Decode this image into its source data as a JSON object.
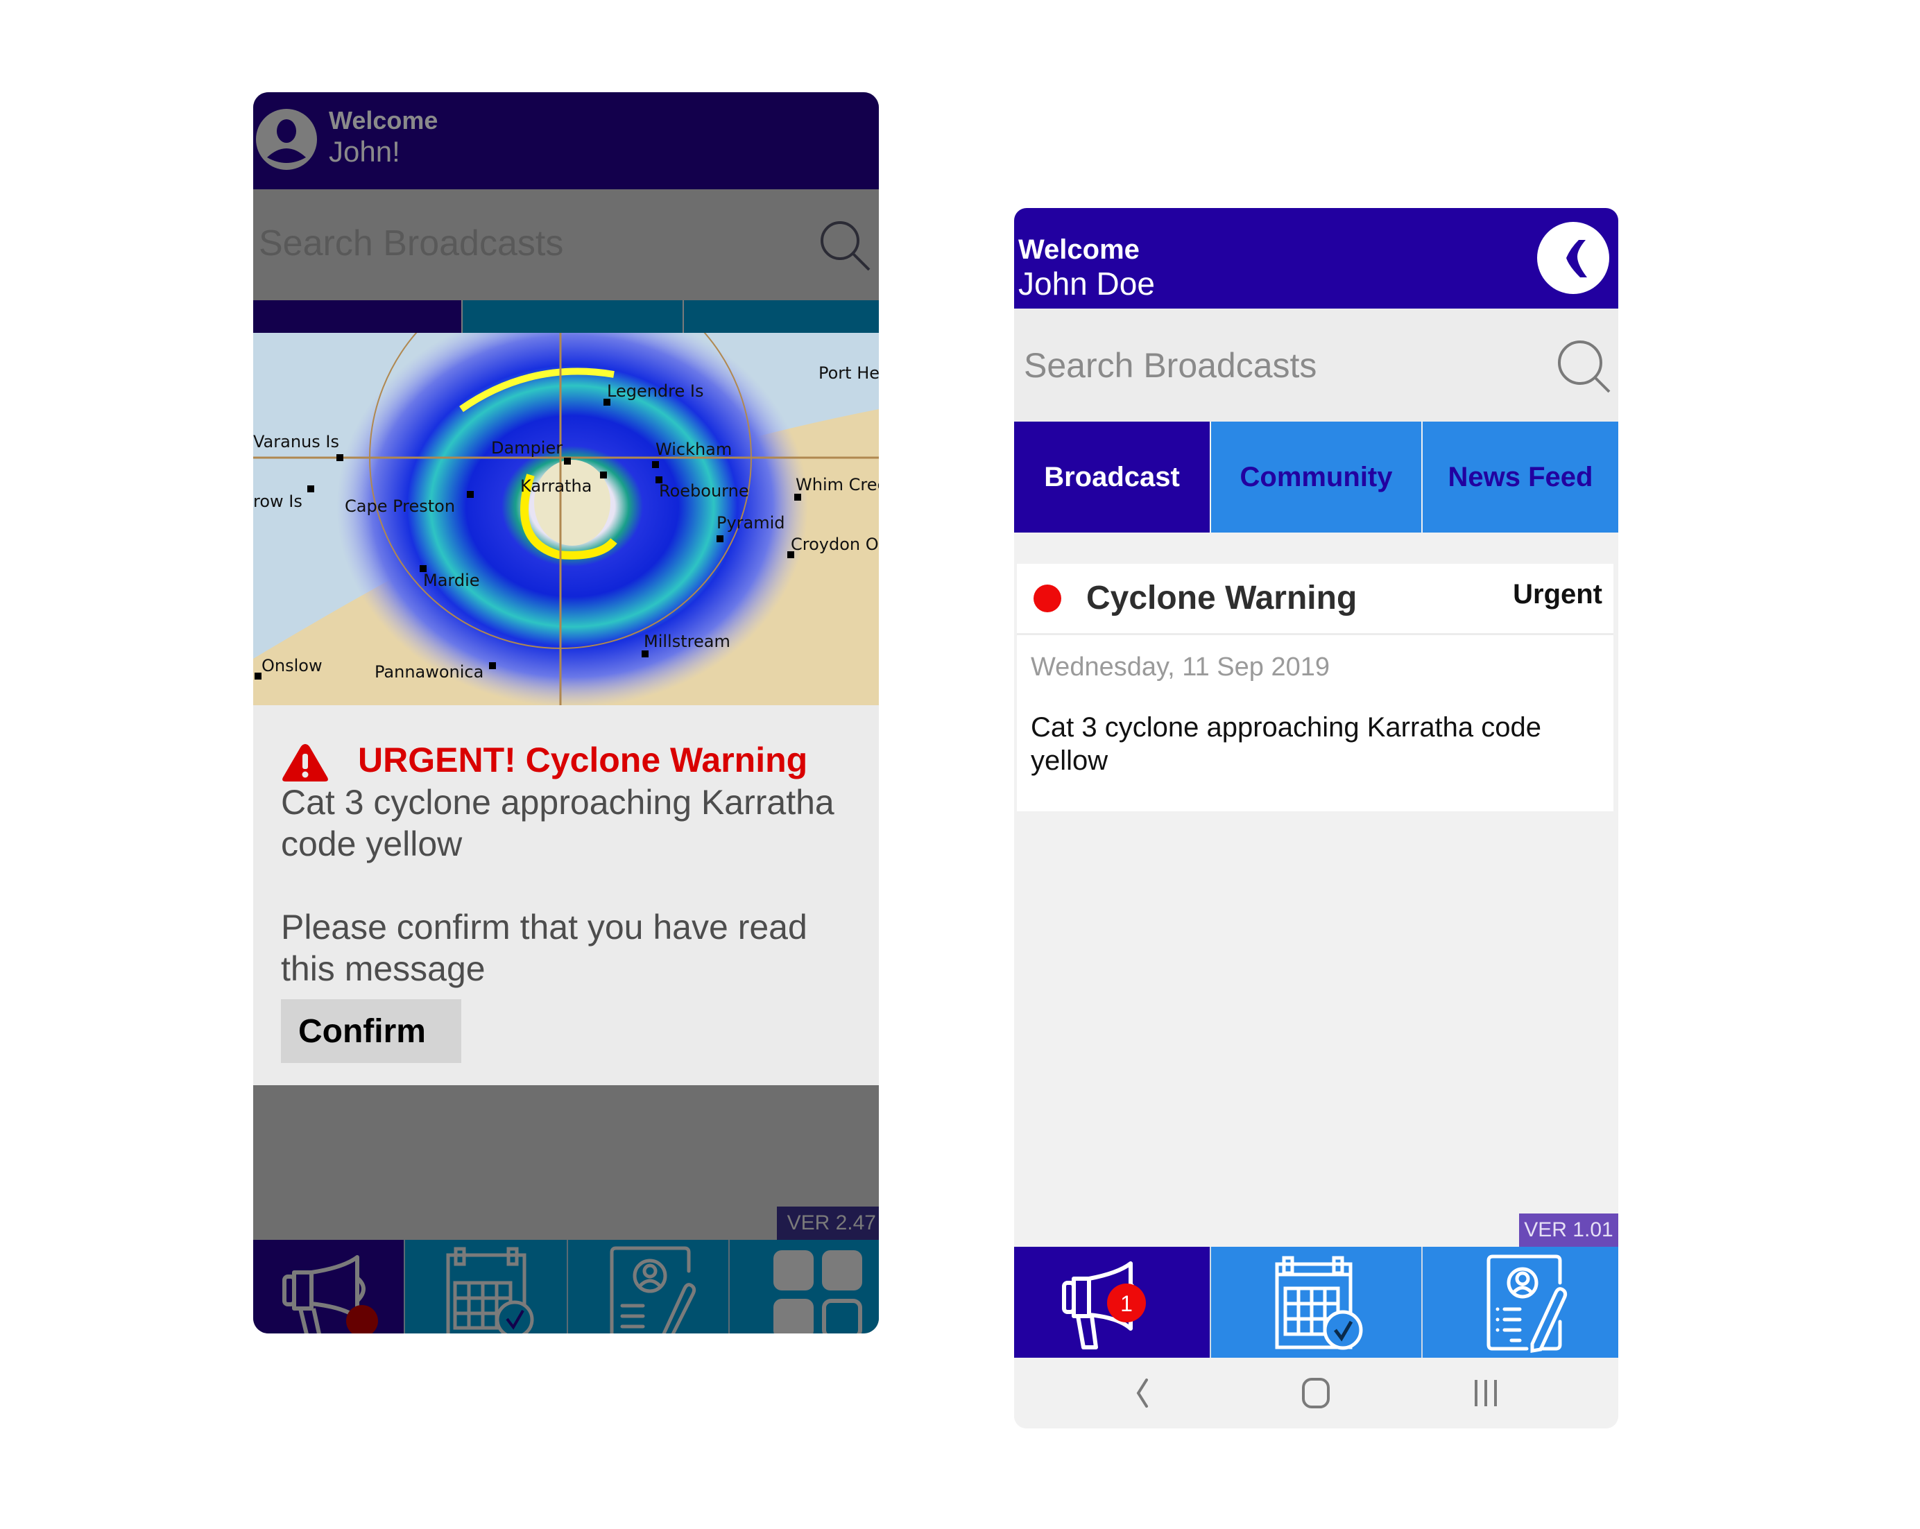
{
  "left_phone": {
    "header": {
      "greeting": "Welcome",
      "user_name": "John!",
      "avatar_icon": "user-circle-icon"
    },
    "search": {
      "placeholder": "Search Broadcasts",
      "value": "",
      "icon": "search-icon"
    },
    "tabs": [
      {
        "label": "",
        "active": true
      },
      {
        "label": "",
        "active": false
      },
      {
        "label": "",
        "active": false
      }
    ],
    "map": {
      "description": "Weather radar image of a cyclone near Karratha",
      "labels": [
        "Port He",
        "Legendre Is",
        "Varanus Is",
        "Dampier",
        "Wickham",
        "Karratha",
        "Roebourne",
        "Whim Cree",
        "row Is",
        "Cape Preston",
        "Pyramid",
        "Croydon O",
        "Mardie",
        "Millstream",
        "Onslow",
        "Pannawonica"
      ]
    },
    "alert": {
      "icon": "warning-triangle-icon",
      "title": "URGENT! Cyclone Warning",
      "body": "Cat 3 cyclone approaching Karratha code yellow",
      "prompt": "Please confirm that you have read this message",
      "confirm_label": "Confirm"
    },
    "version": "VER 2.47",
    "bottom_nav": [
      {
        "icon": "megaphone-icon",
        "active": true,
        "badge": true
      },
      {
        "icon": "calendar-check-icon",
        "active": false
      },
      {
        "icon": "profile-form-icon",
        "active": false
      },
      {
        "icon": "grid-apps-icon",
        "active": false
      }
    ],
    "colors": {
      "header": "#13004c",
      "tab_active": "#13004c",
      "tab_inactive": "#00506e",
      "overlay": "#6e6e6e",
      "alert_red": "#d90000"
    }
  },
  "right_phone": {
    "header": {
      "greeting": "Welcome",
      "user_name": "John Doe",
      "back_icon": "back-arrow-icon"
    },
    "search": {
      "placeholder": "Search Broadcasts",
      "value": "",
      "icon": "search-icon"
    },
    "tabs": [
      {
        "label": "Broadcast",
        "active": true
      },
      {
        "label": "Community",
        "active": false
      },
      {
        "label": "News Feed",
        "active": false
      }
    ],
    "broadcasts": [
      {
        "title": "Cyclone Warning",
        "priority": "Urgent",
        "status_color": "#ee0a0a",
        "date": "Wednesday, 11 Sep 2019",
        "body": "Cat 3 cyclone approaching Karratha code yellow"
      }
    ],
    "version": "VER 1.01",
    "bottom_nav": [
      {
        "icon": "megaphone-icon",
        "active": true,
        "badge_count": "1"
      },
      {
        "icon": "calendar-check-icon",
        "active": false
      },
      {
        "icon": "profile-form-icon",
        "active": false
      }
    ],
    "system_nav": [
      {
        "icon": "back-icon"
      },
      {
        "icon": "home-icon"
      },
      {
        "icon": "recents-icon"
      }
    ],
    "colors": {
      "header": "#2200a0",
      "tab_active": "#2200a0",
      "tab_inactive": "#2a88e6",
      "tab_inactive_text": "#2200a0",
      "version_bg": "#6a4ab8"
    }
  }
}
